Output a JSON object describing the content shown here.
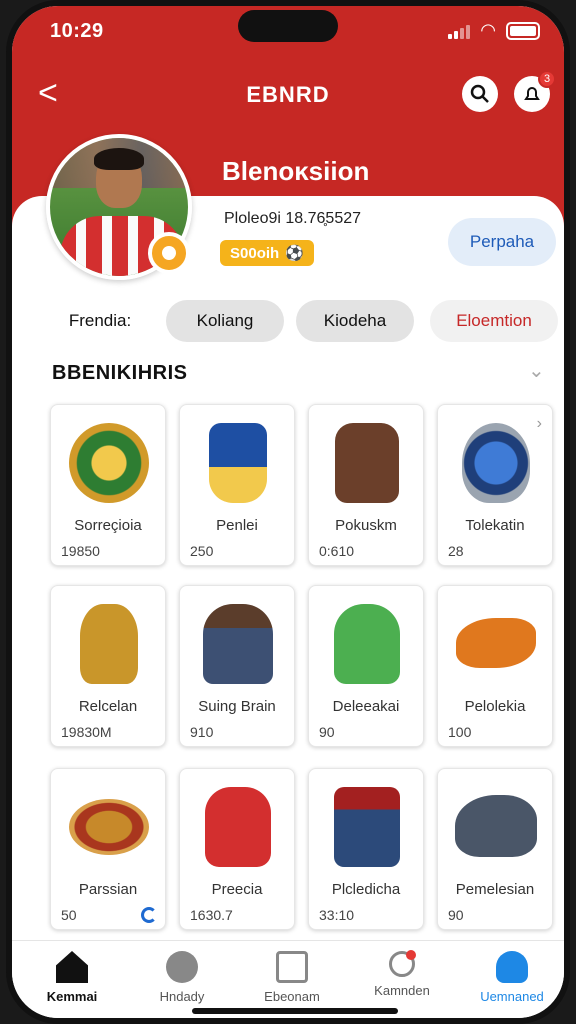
{
  "status": {
    "time": "10:29"
  },
  "header": {
    "title": "EBNRD",
    "back_label": "<",
    "notification_count": "3"
  },
  "profile": {
    "name": "Blenoĸsiion",
    "stats": "Ploleo9i 18.76̥5527",
    "coins": "S00oih",
    "action_label": "Perpaha"
  },
  "tabs": [
    "Frendia:",
    "Koliang",
    "Kiodeha",
    "Eloemtion"
  ],
  "section": {
    "title": "BBENIKIHRIS"
  },
  "items": [
    {
      "name": "Sorreçioia",
      "price": "19850",
      "icon": "emblem-icon"
    },
    {
      "name": "Penlei",
      "price": "250",
      "icon": "jersey-icon"
    },
    {
      "name": "Pokuskm",
      "price": "0:610",
      "icon": "backpack-icon"
    },
    {
      "name": "Tolekatin",
      "price": "28",
      "icon": "badge-icon"
    },
    {
      "name": "Relcelan",
      "price": "19830M",
      "icon": "trophy-icon"
    },
    {
      "name": "Suing Brain",
      "price": "910",
      "icon": "player-icon"
    },
    {
      "name": "Deleeakai",
      "price": "90",
      "icon": "green-jersey-icon"
    },
    {
      "name": "Pelolekia",
      "price": "100",
      "icon": "dragon-icon"
    },
    {
      "name": "Parssian",
      "price": "50",
      "icon": "dish-icon"
    },
    {
      "name": "Preecia",
      "price": "1630.7",
      "icon": "red-bag-icon"
    },
    {
      "name": "Plcledicha",
      "price": "33:10",
      "icon": "drum-icon"
    },
    {
      "name": "Pemelesian",
      "price": "90",
      "icon": "beast-icon"
    }
  ],
  "nav": [
    "Kemmai",
    "Hndady",
    "Ebeonam",
    "Kamnden",
    "Uemnaned"
  ],
  "colors": {
    "brand_red": "#c62824",
    "accent_blue": "#1e88e5",
    "gold": "#f5b31a"
  }
}
